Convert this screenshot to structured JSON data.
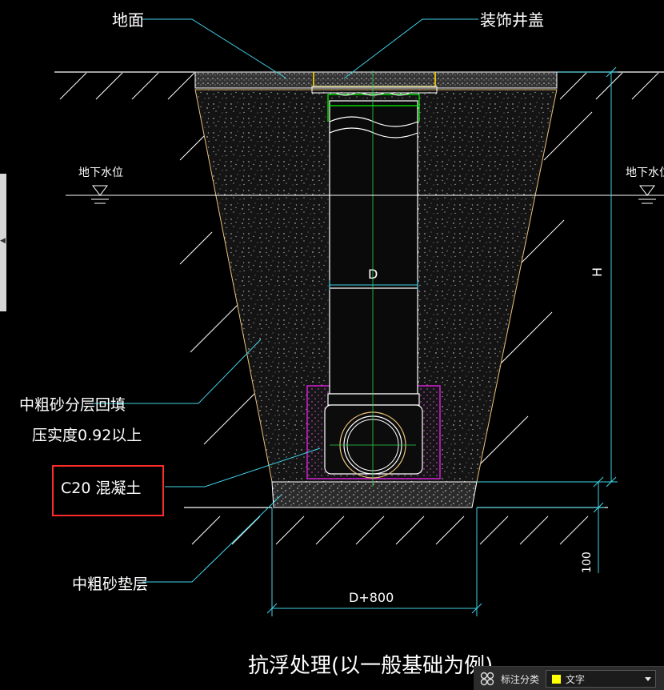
{
  "labels": {
    "ground": "地面",
    "cover": "装饰井盖",
    "water_left": "地下水位",
    "water_right": "地下水位",
    "backfill_line1": "中粗砂分层回填",
    "backfill_line2": "压实度0.92以上",
    "concrete": "C20 混凝土",
    "cushion": "中粗砂垫层",
    "dim_d": "D",
    "dim_h": "H",
    "dim_base": "D+800",
    "dim_100": "100",
    "caption": "抗浮处理(以一般基础为例)"
  },
  "legend_bar": {
    "label": "标注分类",
    "selected": "文字",
    "swatch_color": "#ffff00"
  },
  "colors": {
    "leader": "#3fd3e8",
    "soil_hatch": "#ffffff",
    "pipe": "#ffffff",
    "concrete_outline": "#e020e0",
    "cover": "#ffd700",
    "collar": "#00e000",
    "highlight_box": "#ff2a2a"
  }
}
